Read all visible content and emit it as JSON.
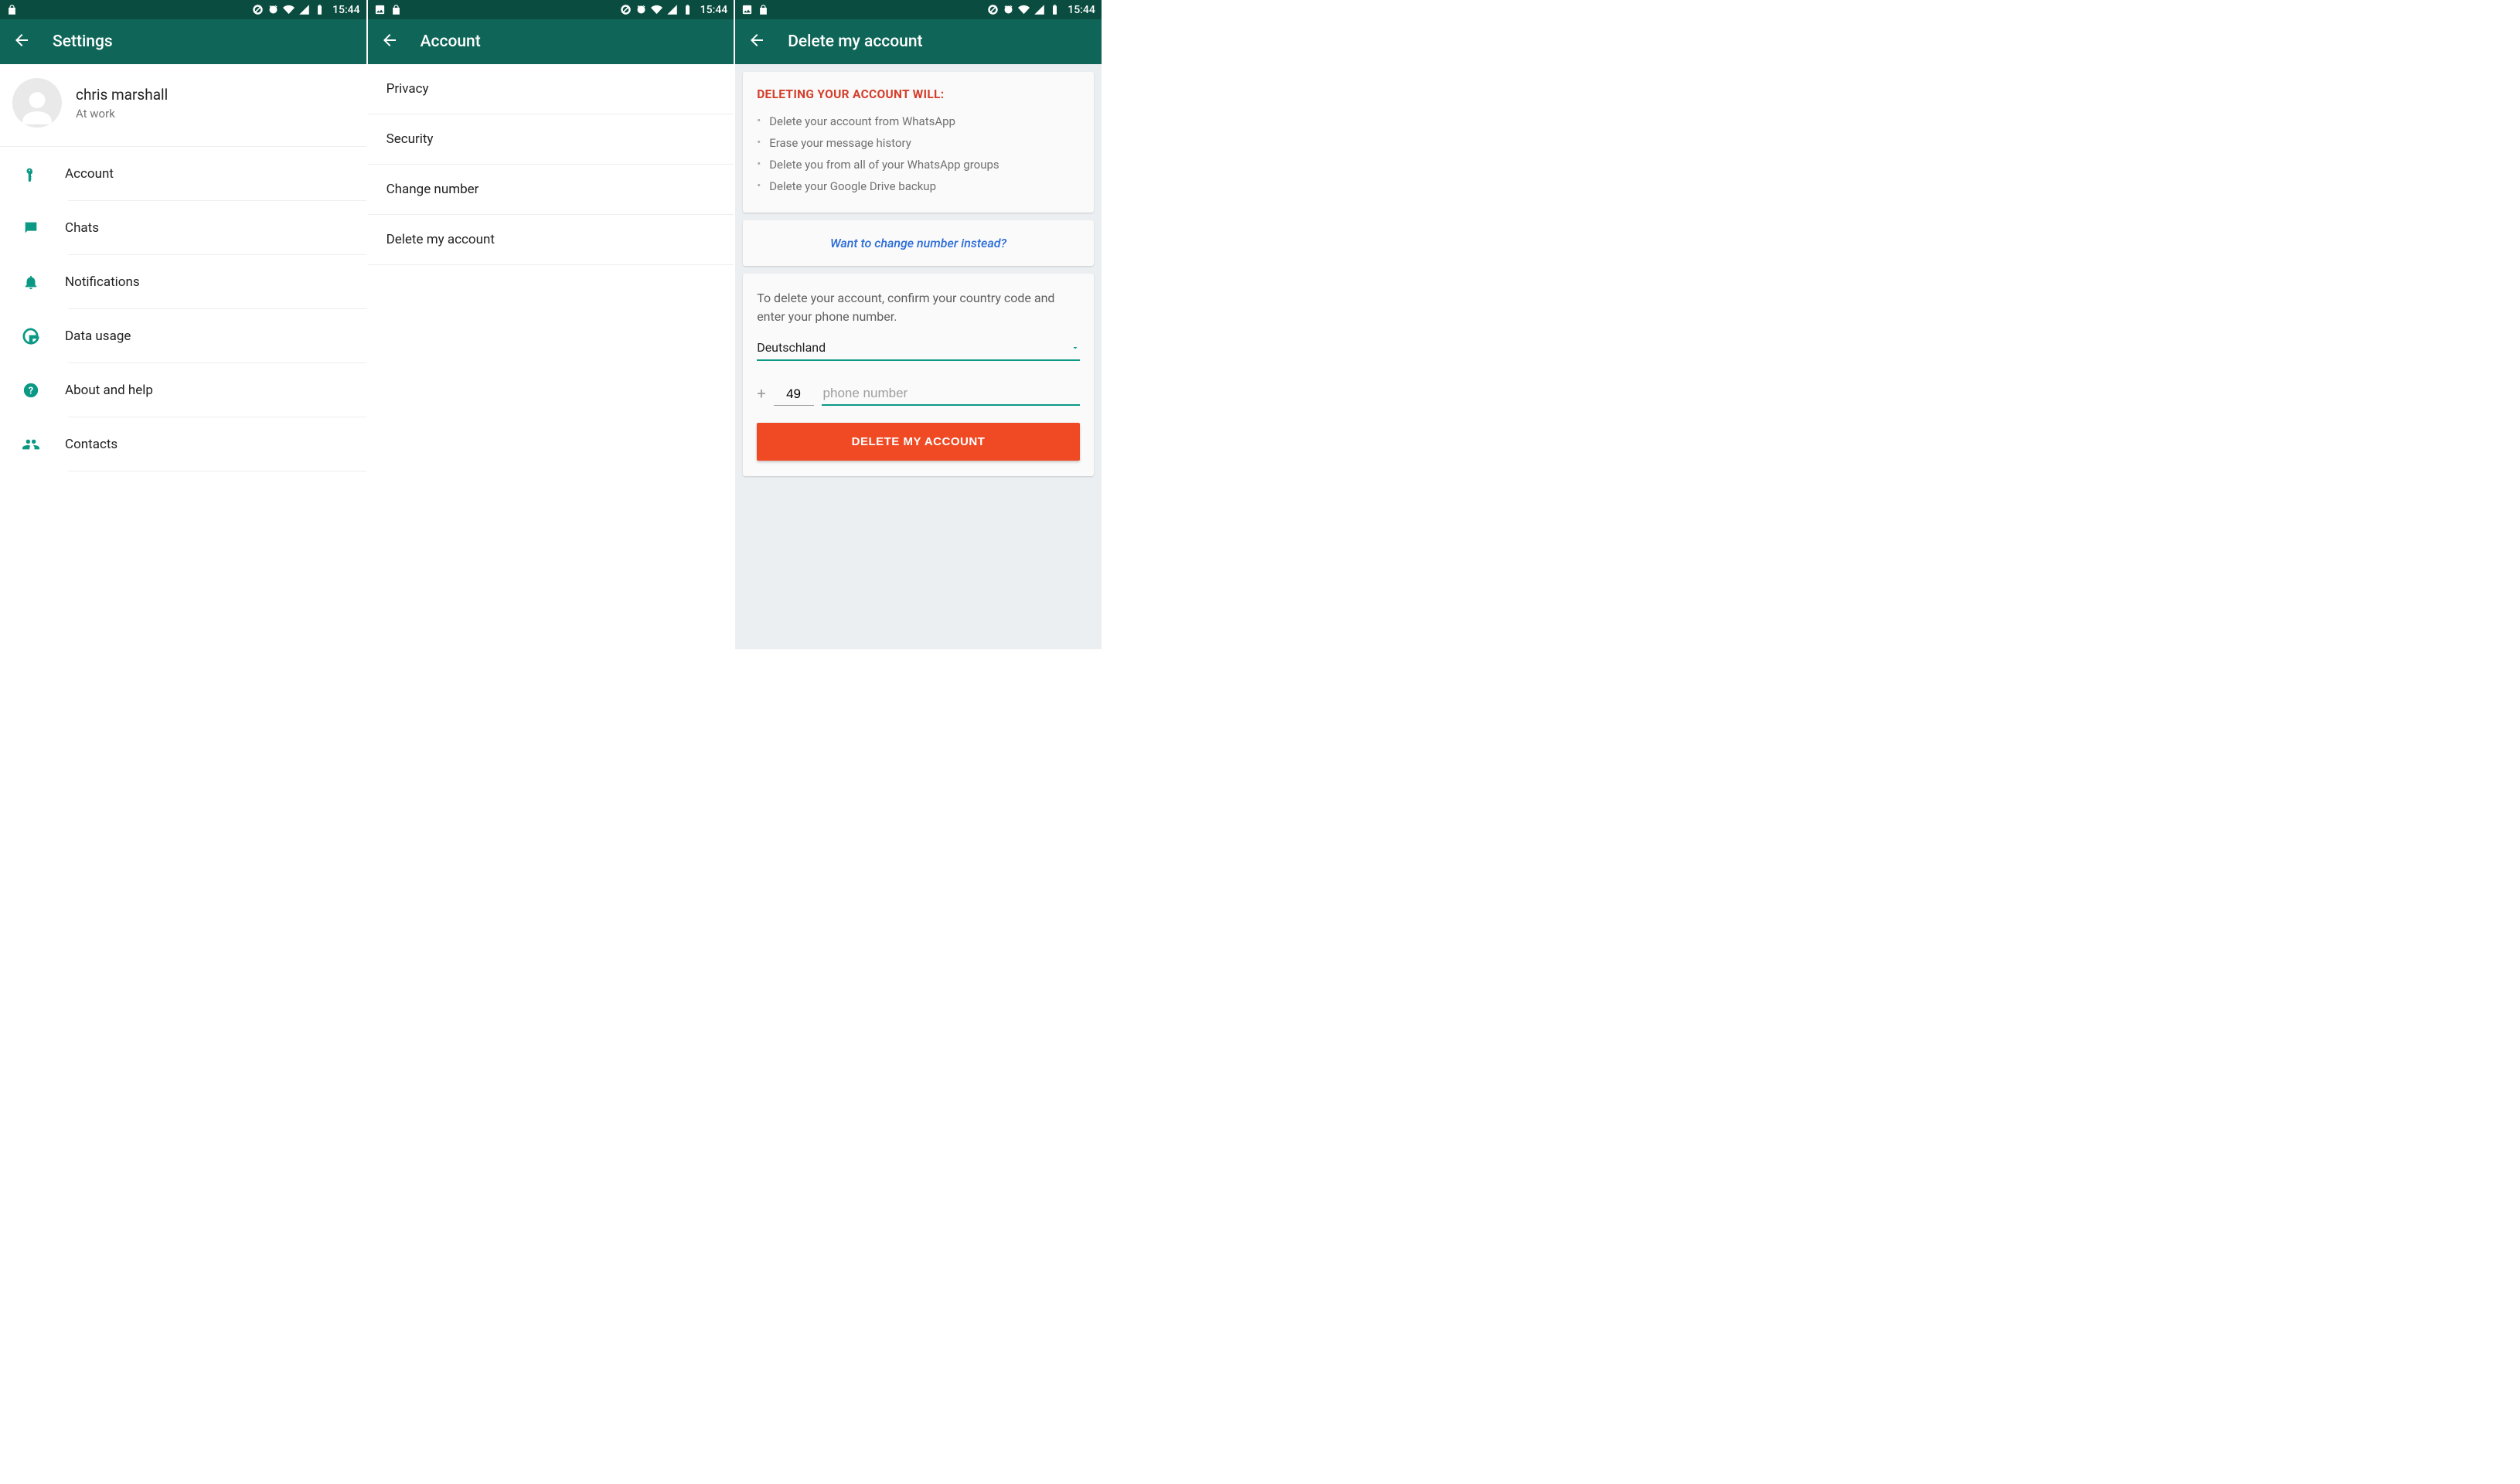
{
  "status": {
    "time": "15:44"
  },
  "screen1": {
    "title": "Settings",
    "profile": {
      "name": "chris marshall",
      "status": "At work"
    },
    "items": [
      {
        "label": "Account"
      },
      {
        "label": "Chats"
      },
      {
        "label": "Notifications"
      },
      {
        "label": "Data usage"
      },
      {
        "label": "About and help"
      },
      {
        "label": "Contacts"
      }
    ]
  },
  "screen2": {
    "title": "Account",
    "items": [
      {
        "label": "Privacy"
      },
      {
        "label": "Security"
      },
      {
        "label": "Change number"
      },
      {
        "label": "Delete my account"
      }
    ]
  },
  "screen3": {
    "title": "Delete my account",
    "warn_title": "DELETING YOUR ACCOUNT WILL:",
    "warn_items": [
      "Delete your account from WhatsApp",
      "Erase your message history",
      "Delete you from all of your WhatsApp groups",
      "Delete your Google Drive backup"
    ],
    "change_link": "Want to change number instead?",
    "confirm_text": "To delete your account, confirm your country code and enter your phone number.",
    "country": "Deutschland",
    "code": "49",
    "phone_placeholder": "phone number",
    "delete_button": "DELETE MY ACCOUNT"
  }
}
